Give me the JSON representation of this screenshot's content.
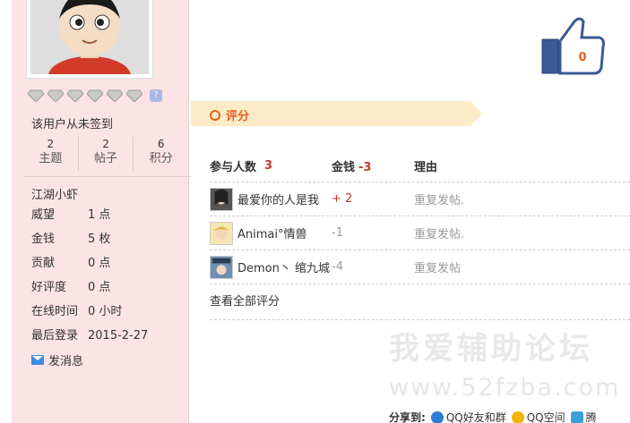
{
  "profile": {
    "checkin_text": "该用户从未签到",
    "stats": [
      {
        "num": "2",
        "label": "主题"
      },
      {
        "num": "2",
        "label": "帖子"
      },
      {
        "num": "6",
        "label": "积分"
      }
    ],
    "rank": "江湖小虾",
    "info": [
      {
        "key": "威望",
        "value": "1 点"
      },
      {
        "key": "金钱",
        "value": "5 枚"
      },
      {
        "key": "贡献",
        "value": "0 点"
      },
      {
        "key": "好评度",
        "value": "0 点"
      },
      {
        "key": "在线时间",
        "value": "0 小时"
      },
      {
        "key": "最后登录",
        "value": "2015-2-27"
      }
    ],
    "send_message": "发消息",
    "medal_help": "?"
  },
  "like": {
    "count": "0"
  },
  "rating": {
    "title": "评分",
    "headers": {
      "participants": "参与人数",
      "participants_count": "3",
      "money": "金钱",
      "money_total": "-3",
      "reason": "理由"
    },
    "rows": [
      {
        "user": "最爱你的人是我",
        "score": "+ 2",
        "reason": "重复发帖."
      },
      {
        "user": "Animai°情兽",
        "score": "-1",
        "reason": "重复发帖."
      },
      {
        "user": "Demon丶 绾九城",
        "score": "-4",
        "reason": "重复发帖"
      }
    ],
    "view_all": "查看全部评分"
  },
  "watermark": {
    "line1": "我爱辅助论坛",
    "line2": "www.52fzba.com"
  },
  "share": {
    "label": "分享到:",
    "items": [
      "QQ好友和群",
      "QQ空间",
      "腾"
    ]
  },
  "colors": {
    "accent": "#e2621c",
    "sidebar_bg": "#fce4e6",
    "banner_bg": "#fdebc8",
    "negative": "#c0392b"
  }
}
